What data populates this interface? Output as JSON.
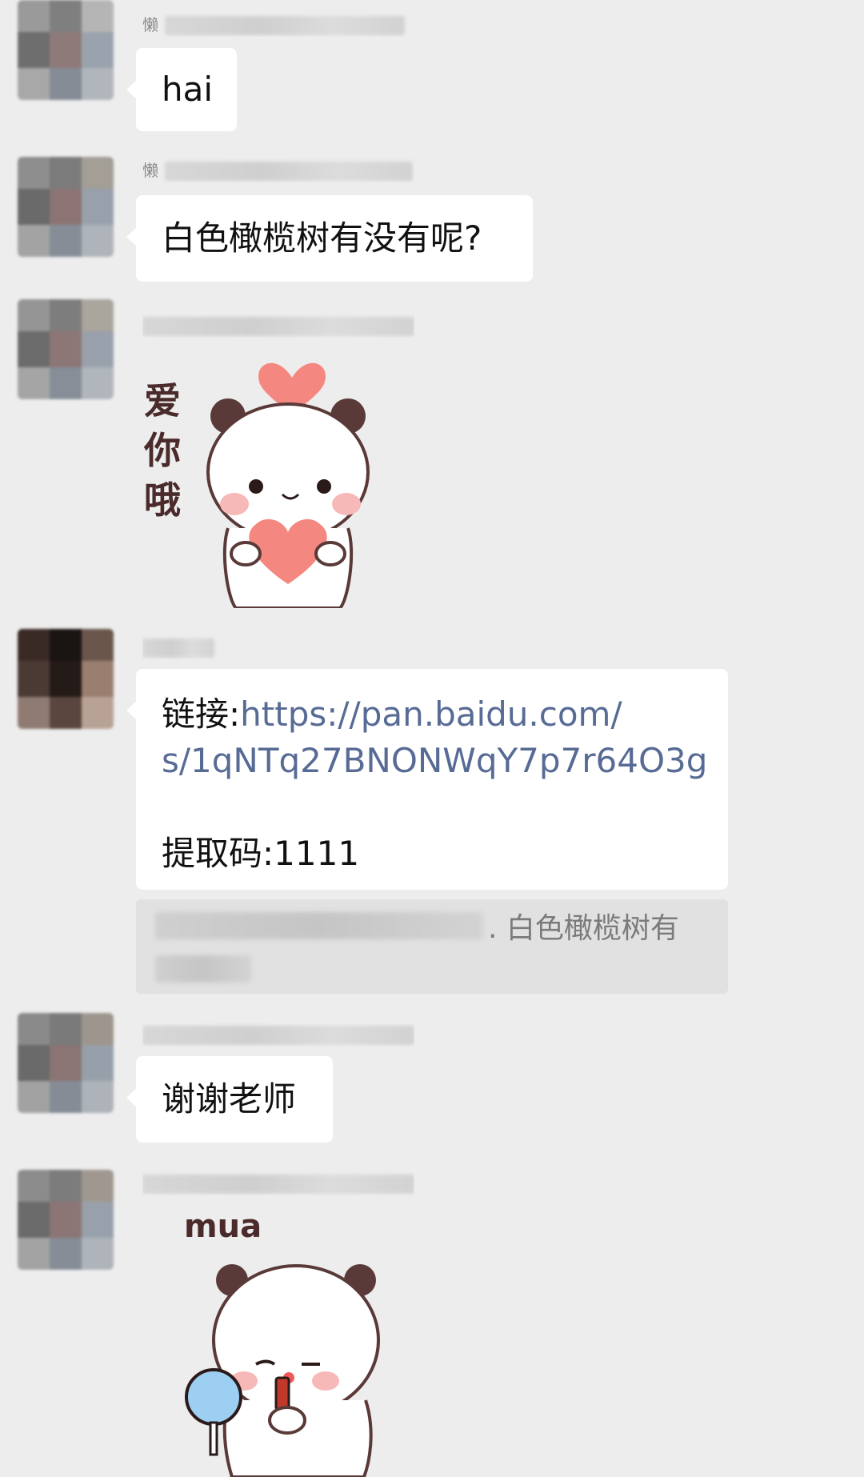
{
  "messages": [
    {
      "sender_visible": "懒",
      "text": "hai"
    },
    {
      "sender_visible": "懒",
      "text": "白色橄榄树有没有呢?"
    },
    {
      "sender_visible": "",
      "sticker_text": "爱你哦"
    },
    {
      "sender_visible": "",
      "link_prefix": "链接:",
      "link_url_1": "https://pan.baidu.com/",
      "link_url_2": "s/1qNTq27BNONWqY7p7r64O3g",
      "code_text": "提取码:1111"
    },
    {
      "quote_text": ". 白色橄榄树有"
    },
    {
      "sender_visible": "",
      "text": "谢谢老师"
    },
    {
      "sender_visible": "",
      "sticker_text": "mua"
    }
  ],
  "colors": {
    "background": "#ededed",
    "bubble": "#ffffff",
    "link": "#576b95",
    "quote_bg": "#e1e1e1"
  }
}
